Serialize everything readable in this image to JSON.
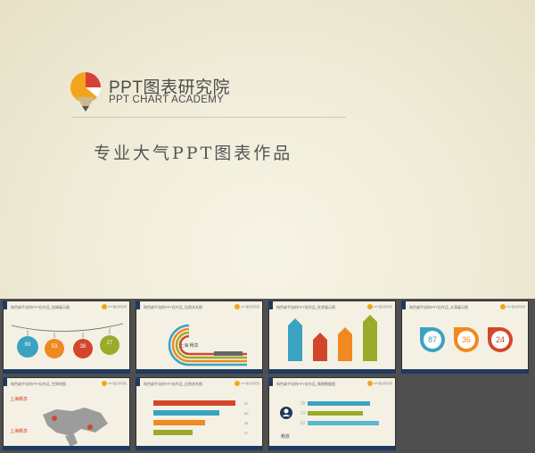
{
  "main": {
    "logo_title": "PPT图表研究院",
    "logo_subtitle": "PPT CHART ACADEMY",
    "slogan": "专业大气PPT图表作品"
  },
  "thumbnails": [
    {
      "title": "纯色扁平化的PPT化作品_挂绳展示图",
      "values": [
        "69",
        "53",
        "38",
        "27"
      ]
    },
    {
      "title": "纯色扁平化的PPT化作品_比例关系图",
      "label": "上海 畅享"
    },
    {
      "title": "纯色扁平化的PPT化作品_柱状展示图"
    },
    {
      "title": "纯色扁平化的PPT化作品_水滴展示图",
      "values": [
        "87",
        "36",
        "24"
      ]
    },
    {
      "title": "纯色扁平化的PPT化作品_世界地图",
      "labels": [
        "上海畅享",
        "上海畅享"
      ]
    },
    {
      "title": "纯色扁平化的PPT化作品_比例关系图",
      "values": [
        "67",
        "50",
        "38",
        "27"
      ]
    },
    {
      "title": "纯色扁平化的PPT化作品_情景数据图",
      "values": [
        "39",
        "19",
        "82"
      ],
      "label": "畅意"
    }
  ],
  "thumb_logo": "PPT图表研究院",
  "colors": {
    "blue": "#3aa3c2",
    "orange": "#f0891f",
    "red": "#d2472b",
    "green": "#9aab2a",
    "navy": "#1e3a5f",
    "yellow": "#f2a51c"
  }
}
